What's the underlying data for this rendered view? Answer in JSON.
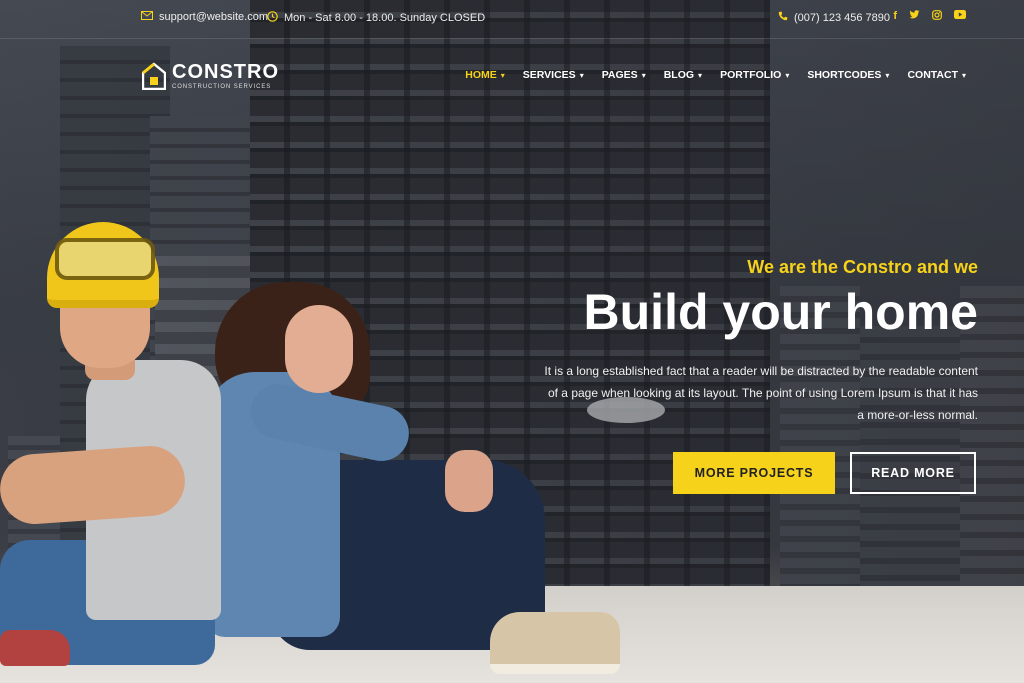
{
  "topbar": {
    "email": "support@website.com",
    "hours": "Mon - Sat 8.00 - 18.00. Sunday CLOSED",
    "phone": "(007) 123 456 7890",
    "social_icons": [
      "facebook-icon",
      "twitter-icon",
      "instagram-icon",
      "youtube-icon"
    ]
  },
  "logo": {
    "name": "CONSTRO",
    "tagline": "CONSTRUCTION SERVICES"
  },
  "nav": {
    "items": [
      {
        "label": "HOME",
        "active": true
      },
      {
        "label": "SERVICES"
      },
      {
        "label": "PAGES"
      },
      {
        "label": "BLOG"
      },
      {
        "label": "PORTFOLIO"
      },
      {
        "label": "SHORTCODES"
      },
      {
        "label": "CONTACT"
      }
    ]
  },
  "hero": {
    "eyebrow": "We are the Constro and we",
    "headline": "Build your home",
    "description": "It is a long established fact that a reader will be distracted by the readable content of a page when looking at its layout. The point of using Lorem Ipsum is that it has a more-or-less normal.",
    "primary_button": "MORE PROJECTS",
    "secondary_button": "READ MORE"
  },
  "colors": {
    "accent": "#f7d21a",
    "text": "#ffffff"
  }
}
